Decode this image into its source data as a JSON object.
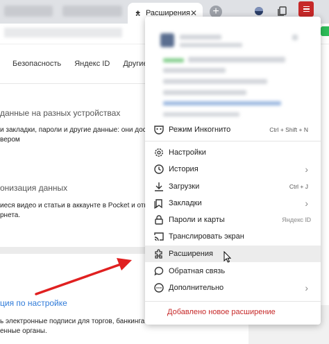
{
  "tabs": {
    "active_label": "Расширения",
    "close_glyph": "✕",
    "new_tab_glyph": "+"
  },
  "page": {
    "nav": [
      "Безопасность",
      "Яндекс ID",
      "Другие уст"
    ],
    "section1_title": "данные на разных устройствах",
    "section1_line1": "и закладки, пароли и другие данные: они дос",
    "section1_line2": "вером",
    "section2_title": "онизация данных",
    "section2_line1": "иеся видео и статьи в аккаунте в Pocket и отк",
    "section2_line2": "рнета.",
    "link": "ция по настройке",
    "bottom_line1": "ь электронные подписи для торгов, банкинга и ведом",
    "bottom_line2": "енные органы."
  },
  "menu": {
    "incognito": {
      "label": "Режим Инкогнито",
      "shortcut": "Ctrl + Shift + N"
    },
    "items": [
      {
        "label": "Настройки"
      },
      {
        "label": "История"
      },
      {
        "label": "Загрузки",
        "shortcut": "Ctrl + J"
      },
      {
        "label": "Закладки"
      },
      {
        "label": "Пароли и карты",
        "badge": "Яндекс ID"
      },
      {
        "label": "Транслировать экран"
      },
      {
        "label": "Расширения"
      },
      {
        "label": "Обратная связь"
      },
      {
        "label": "Дополнительно"
      }
    ],
    "note": "Добавлено новое расширение"
  },
  "colors": {
    "accent_red": "#c62828",
    "link_blue": "#2f7bd9",
    "hover_bg": "#ececec"
  },
  "icons": [
    "puzzle-icon",
    "incognito-mask-icon",
    "gear-icon",
    "clock-icon",
    "download-icon",
    "bookmarks-icon",
    "key-icon",
    "cast-icon",
    "puzzle-icon",
    "feedback-icon",
    "more-icon"
  ]
}
